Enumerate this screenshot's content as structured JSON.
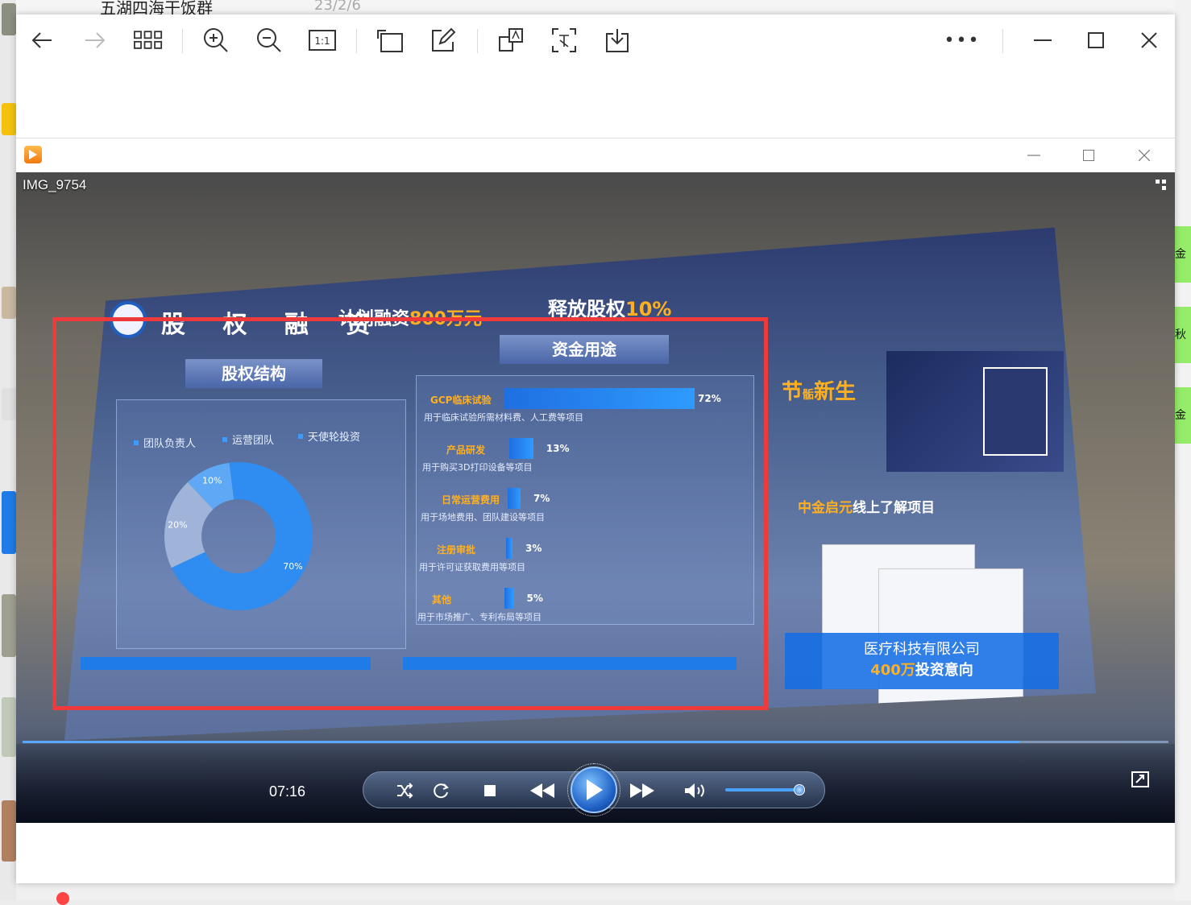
{
  "background_chat": {
    "title": "五湖四海干饭群",
    "date": "23/2/6",
    "right_snippets": [
      "金月",
      "秋",
      "金月"
    ]
  },
  "viewer_toolbar": {
    "icons": [
      "back-arrow-icon",
      "forward-arrow-icon",
      "grid-view-icon",
      "zoom-in-icon",
      "zoom-out-icon",
      "actual-size-icon",
      "rotate-icon",
      "edit-icon",
      "translate-icon",
      "extract-text-icon",
      "download-icon",
      "more-icon",
      "minimize-icon",
      "maximize-icon",
      "close-icon"
    ],
    "actual_size_label": "1:1",
    "more_label": "•••"
  },
  "player": {
    "filename": "IMG_9754",
    "time": "07:16",
    "progress_fraction": 0.87,
    "volume_fraction": 0.92
  },
  "slide": {
    "title": "股 权 融 资",
    "plan_prefix": "计划融资",
    "plan_amount": "800万元",
    "release_prefix": "释放股权",
    "release_pct": "10%",
    "equity": {
      "heading": "股权结构",
      "legend": [
        "团队负责人",
        "运营团队",
        "天使轮投资"
      ]
    },
    "funds": {
      "heading": "资金用途",
      "rows": [
        {
          "name": "GCP临床试验",
          "pct": "72%",
          "desc": "用于临床试验所需材料费、人工费等项目"
        },
        {
          "name": "产品研发",
          "pct": "13%",
          "desc": "用于购买3D打印设备等项目"
        },
        {
          "name": "日常运营费用",
          "pct": "7%",
          "desc": "用于场地费用、团队建设等项目"
        },
        {
          "name": "注册审批",
          "pct": "3%",
          "desc": "用于许可证获取费用等项目"
        },
        {
          "name": "其他",
          "pct": "5%",
          "desc": "用于市场推广、专利布局等项目"
        }
      ]
    },
    "right": {
      "headline_a": "节",
      "headline_small": "骺",
      "headline_b": "新生",
      "tagline_a": "中金启元",
      "tagline_b": "线上了解项目",
      "banner_l1": "医疗科技有限公司",
      "banner_amount": "400万",
      "banner_l2_rest": "投资意向"
    }
  },
  "chart_data": {
    "type": "pie",
    "title": "股权结构",
    "categories": [
      "团队负责人",
      "运营团队",
      "天使轮投资"
    ],
    "values": [
      70,
      20,
      10
    ],
    "unit": "%",
    "colors": [
      "#2f8cf0",
      "#9fb4d8",
      "#5fa8f5"
    ],
    "donut": true
  },
  "funds_chart_data": {
    "type": "bar",
    "title": "资金用途",
    "categories": [
      "GCP临床试验",
      "产品研发",
      "日常运营费用",
      "注册审批",
      "其他"
    ],
    "values": [
      72,
      13,
      7,
      3,
      5
    ],
    "unit": "%"
  }
}
